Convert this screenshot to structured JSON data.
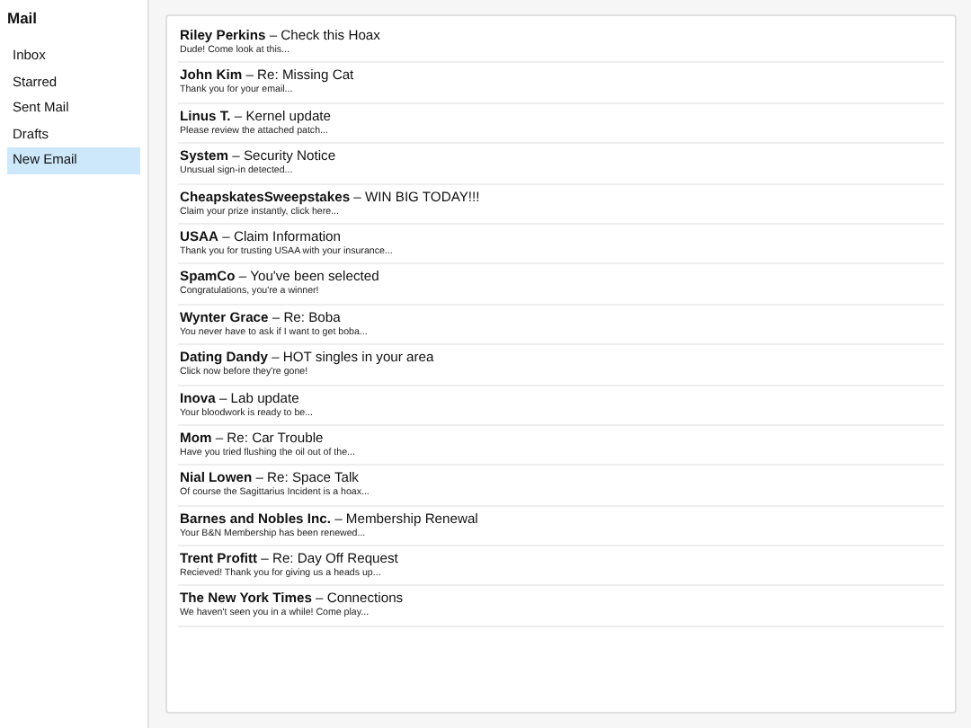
{
  "sidebar": {
    "title": "Mail",
    "items": [
      {
        "label": "Inbox",
        "selected": false
      },
      {
        "label": "Starred",
        "selected": false
      },
      {
        "label": "Sent Mail",
        "selected": false
      },
      {
        "label": "Drafts",
        "selected": false
      },
      {
        "label": "New Email",
        "selected": true
      }
    ]
  },
  "messages": [
    {
      "title": "**Riley Perkins** – Check this Hoax",
      "preview": "Dude! Come look at this..."
    },
    {
      "title": "**John Kim** – Re: Missing Cat",
      "preview": "Thank you for your email..."
    },
    {
      "title": "**Linus T.** – Kernel update",
      "preview": "Please review the attached patch..."
    },
    {
      "title": "**System** – Security Notice",
      "preview": "Unusual sign-in detected..."
    },
    {
      "title": "**CheapskatesSweepstakes** – WIN BIG TODAY!!!",
      "preview": "Claim your prize instantly, click here..."
    },
    {
      "title": "**USAA** – Claim Information",
      "preview": "Thank you for trusting USAA with your insurance..."
    },
    {
      "title": "**SpamCo** – You've been selected",
      "preview": "Congratulations, you're a winner!"
    },
    {
      "title": "**Wynter Grace** – Re: Boba",
      "preview": "You never have to ask if I want to get boba..."
    },
    {
      "title": "**Dating Dandy** – HOT singles in your area",
      "preview": "Click now before they're gone!"
    },
    {
      "title": "**Inova** – Lab update",
      "preview": "Your bloodwork is ready to be..."
    },
    {
      "title": "**Mom** – Re: Car Trouble",
      "preview": "Have you tried flushing the oil out of the..."
    },
    {
      "title": "**Nial Lowen** – Re: Space Talk",
      "preview": "Of course the Sagittarius Incident is a hoax..."
    },
    {
      "title": "**Barnes and Nobles Inc.** – Membership Renewal",
      "preview": "Your B&N Membership has been renewed..."
    },
    {
      "title": "**Trent Profitt** – Re: Day Off Request",
      "preview": "Recieved! Thank you for giving us a heads up..."
    },
    {
      "title": "**The New York Times** – Connections",
      "preview": "We haven't seen you in a while! Come play..."
    }
  ]
}
